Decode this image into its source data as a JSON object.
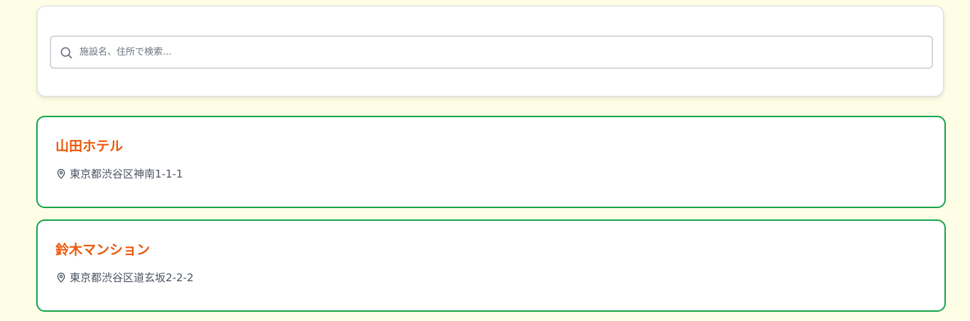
{
  "search": {
    "placeholder": "施設名、住所で検索...",
    "value": "",
    "icon": "search-icon"
  },
  "colors": {
    "background": "#fefee6",
    "card_border": "#16a34a",
    "facility_name": "#ea580c",
    "address_text": "#4b5563"
  },
  "facilities": [
    {
      "name": "山田ホテル",
      "address": "東京都渋谷区神南1-1-1",
      "icon": "map-pin-icon"
    },
    {
      "name": "鈴木マンション",
      "address": "東京都渋谷区道玄坂2-2-2",
      "icon": "map-pin-icon"
    }
  ]
}
